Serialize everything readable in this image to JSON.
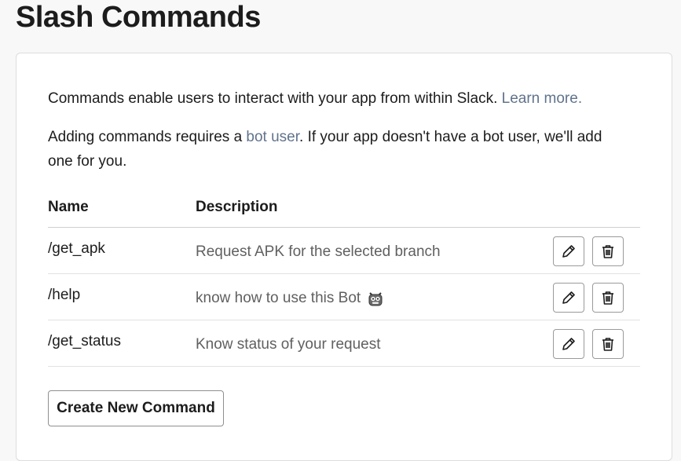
{
  "page": {
    "title": "Slash Commands"
  },
  "intro": {
    "line1_text": "Commands enable users to interact with your app from within Slack.",
    "line1_link": "Learn more.",
    "line2_before": "Adding commands requires a",
    "line2_link": "bot user",
    "line2_after": ". If your app doesn't have a bot user, we'll add one for you."
  },
  "table": {
    "headers": {
      "name": "Name",
      "description": "Description"
    },
    "rows": [
      {
        "name": "/get_apk",
        "description": "Request APK for the selected branch",
        "has_emoji": false
      },
      {
        "name": "/help",
        "description": "know how to use this Bot",
        "has_emoji": true,
        "emoji_icon": "robot-face-icon"
      },
      {
        "name": "/get_status",
        "description": "Know status of your request",
        "has_emoji": false
      }
    ],
    "row_actions": {
      "edit_icon": "pencil-icon",
      "delete_icon": "trash-icon"
    }
  },
  "actions": {
    "create_label": "Create New Command"
  },
  "colors": {
    "link": "#61738c",
    "background": "#f8f8f8",
    "card": "#ffffff",
    "text": "#1d1c1d",
    "muted_text": "#616061"
  }
}
